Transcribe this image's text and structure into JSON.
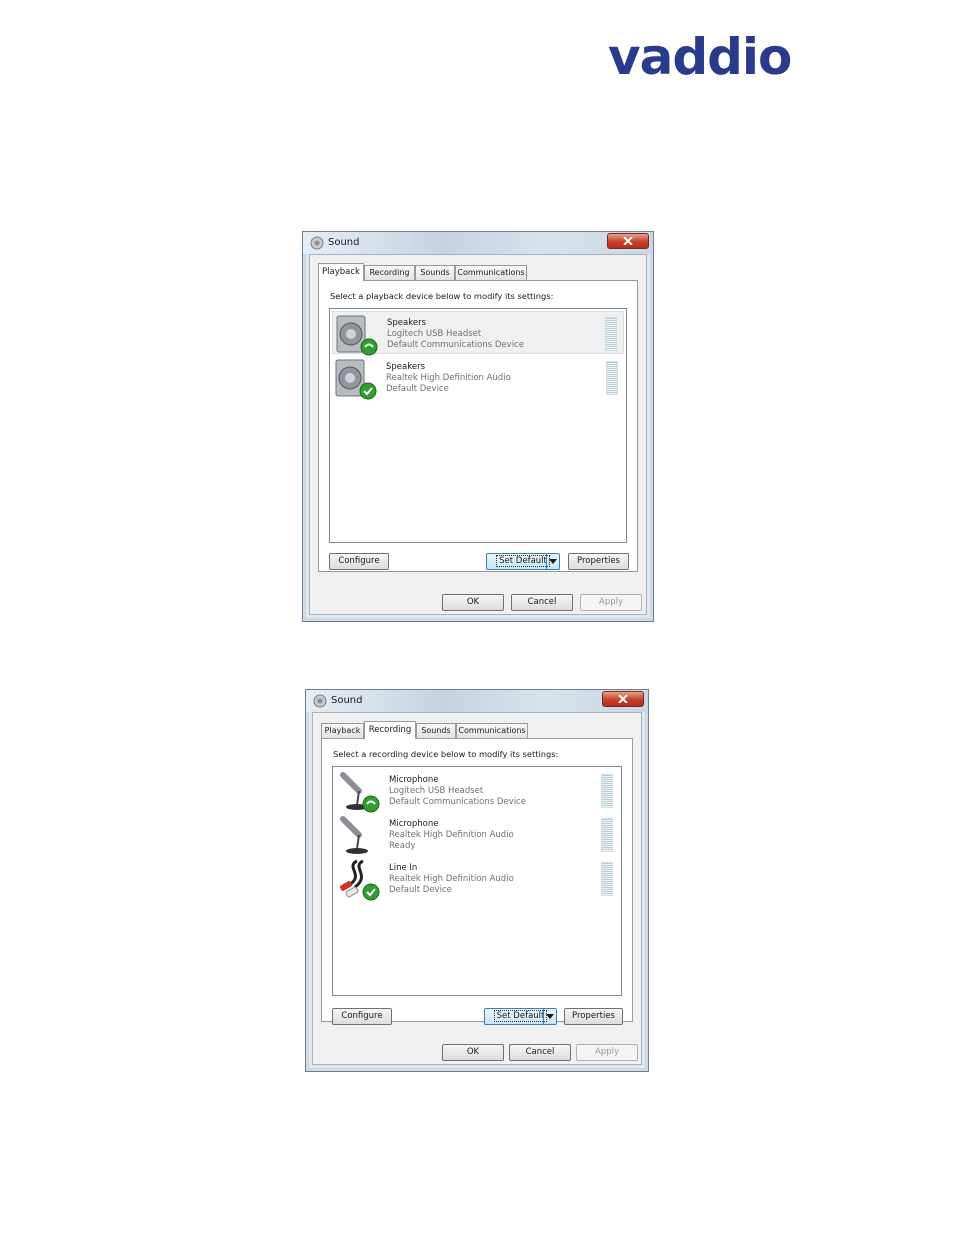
{
  "logo": {
    "text": "vaddio",
    "color": "#2b3b8c"
  },
  "dialogs": [
    {
      "title": "Sound",
      "tabs": [
        "Playback",
        "Recording",
        "Sounds",
        "Communications"
      ],
      "active_tab": "Playback",
      "instruction": "Select a playback device below to modify its settings:",
      "devices": [
        {
          "name": "Speakers",
          "driver": "Logitech USB Headset",
          "status": "Default Communications Device",
          "icon": "speaker-icon",
          "badge": "phone-badge-icon",
          "selected": true
        },
        {
          "name": "Speakers",
          "driver": "Realtek High Definition Audio",
          "status": "Default Device",
          "icon": "speaker-icon",
          "badge": "checkmark-badge-icon",
          "selected": false
        }
      ],
      "buttons": {
        "configure": "Configure",
        "set_default": "Set Default",
        "properties": "Properties",
        "ok": "OK",
        "cancel": "Cancel",
        "apply": "Apply"
      }
    },
    {
      "title": "Sound",
      "tabs": [
        "Playback",
        "Recording",
        "Sounds",
        "Communications"
      ],
      "active_tab": "Recording",
      "instruction": "Select a recording device below to modify its settings:",
      "devices": [
        {
          "name": "Microphone",
          "driver": "Logitech USB Headset",
          "status": "Default Communications Device",
          "icon": "microphone-icon",
          "badge": "phone-badge-icon",
          "selected": false
        },
        {
          "name": "Microphone",
          "driver": "Realtek High Definition Audio",
          "status": "Ready",
          "icon": "microphone-icon",
          "badge": "",
          "selected": false
        },
        {
          "name": "Line In",
          "driver": "Realtek High Definition Audio",
          "status": "Default Device",
          "icon": "line-in-cable-icon",
          "badge": "checkmark-badge-icon",
          "selected": false
        }
      ],
      "buttons": {
        "configure": "Configure",
        "set_default": "Set Default",
        "properties": "Properties",
        "ok": "OK",
        "cancel": "Cancel",
        "apply": "Apply"
      }
    }
  ]
}
